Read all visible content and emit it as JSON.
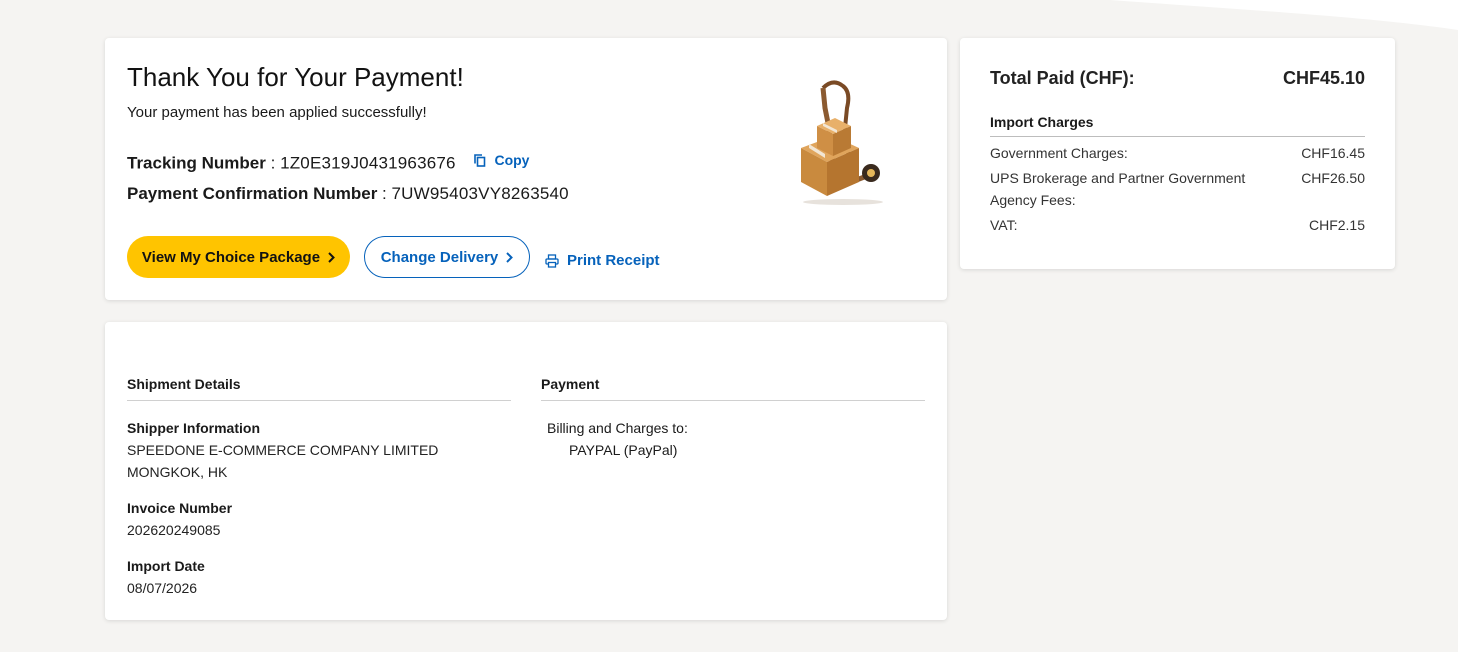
{
  "confirmation": {
    "title": "Thank You for Your Payment!",
    "subtitle": "Your payment has been applied successfully!",
    "tracking_label": "Tracking Number",
    "tracking_value": "1Z0E319J0431963676",
    "copy_label": "Copy",
    "confirmation_label": "Payment Confirmation Number",
    "confirmation_value": "7UW95403VY8263540",
    "view_button": "View My Choice Package",
    "change_button": "Change Delivery",
    "print_label": "Print Receipt"
  },
  "summary": {
    "total_label": "Total Paid (CHF):",
    "total_value": "CHF45.10",
    "import_heading": "Import Charges",
    "charges": [
      {
        "label": "Government Charges:",
        "value": "CHF16.45"
      },
      {
        "label": "UPS Brokerage and Partner Government Agency Fees:",
        "value": "CHF26.50"
      },
      {
        "label": "VAT:",
        "value": "CHF2.15"
      }
    ]
  },
  "details": {
    "shipment_heading": "Shipment Details",
    "shipper_label": "Shipper Information",
    "shipper_name": "SPEEDONE E-COMMERCE COMPANY LIMITED",
    "shipper_location": "MONGKOK, HK",
    "invoice_label": "Invoice Number",
    "invoice_value": "202620249085",
    "import_date_label": "Import Date",
    "import_date_value": "08/07/2026",
    "payment_heading": "Payment",
    "billing_label": "Billing and Charges to:",
    "billing_value": "PAYPAL (PayPal)"
  },
  "colors": {
    "accent_yellow": "#ffc400",
    "link_blue": "#0662bb",
    "background": "#f5f4f2"
  },
  "icons": [
    "copy-icon",
    "chevron-right-icon",
    "printer-icon",
    "hand-truck-boxes-illustration"
  ]
}
